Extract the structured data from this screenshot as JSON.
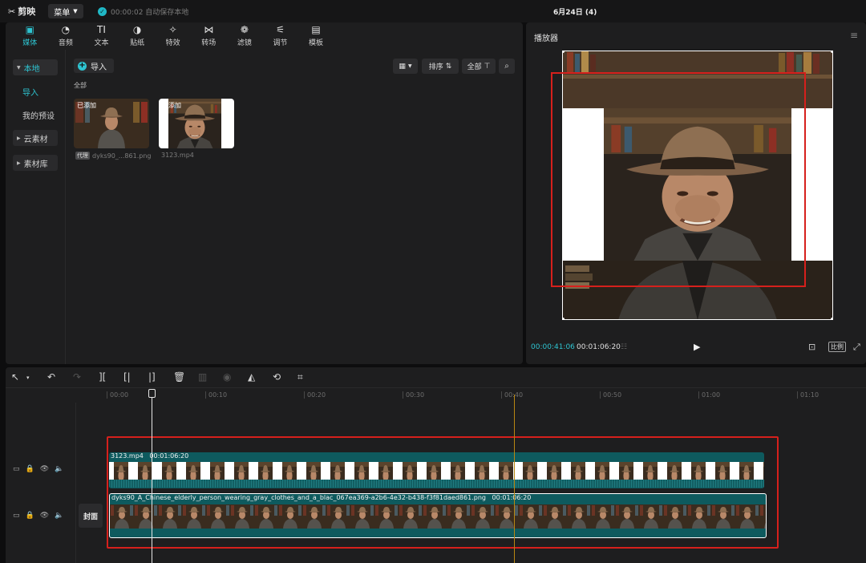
{
  "app": {
    "name": "剪映",
    "menu_label": "菜单",
    "autosave": "00:00:02 自动保存本地",
    "project_title": "6月24日 (4)"
  },
  "toolbar": {
    "tabs": [
      {
        "label": "媒体",
        "icon": "media-icon",
        "glyph": "▣"
      },
      {
        "label": "音频",
        "icon": "audio-icon",
        "glyph": "◔"
      },
      {
        "label": "文本",
        "icon": "text-icon",
        "glyph": "TI"
      },
      {
        "label": "贴纸",
        "icon": "sticker-icon",
        "glyph": "◑"
      },
      {
        "label": "特效",
        "icon": "effects-icon",
        "glyph": "✧"
      },
      {
        "label": "转场",
        "icon": "transition-icon",
        "glyph": "⋈"
      },
      {
        "label": "滤镜",
        "icon": "filter-icon",
        "glyph": "❁"
      },
      {
        "label": "调节",
        "icon": "adjust-icon",
        "glyph": "⚟"
      },
      {
        "label": "模板",
        "icon": "template-icon",
        "glyph": "▤"
      }
    ]
  },
  "sidebar": {
    "local": "本地",
    "import": "导入",
    "my_presets": "我的预设",
    "cloud": "云素材",
    "library": "素材库"
  },
  "media": {
    "import_label": "导入",
    "all_label": "全部",
    "sort_label": "排序",
    "filter_label": "全部",
    "items": [
      {
        "badge": "已添加",
        "filename": "dyks90_...861.png",
        "tag": "代理"
      },
      {
        "badge": "已添加",
        "duration": "01",
        "filename": "3123.mp4"
      }
    ]
  },
  "player": {
    "title": "播放器",
    "current_time": "00:00:41:06",
    "total_time": "00:01:06:20",
    "ratio_label": "比例"
  },
  "timeline": {
    "ruler": [
      "00:00",
      "00:10",
      "00:20",
      "00:30",
      "00:40",
      "00:50",
      "01:00",
      "01:10"
    ],
    "cover_label": "封面",
    "clips": [
      {
        "name": "3123.mp4",
        "duration": "00:01:06:20"
      },
      {
        "name": "dyks90_A_Chinese_elderly_person_wearing_gray_clothes_and_a_blac_067ea369-a2b6-4e32-b438-f3f81daed861.png",
        "duration": "00:01:06:20"
      }
    ]
  },
  "colors": {
    "accent": "#2ec4d1",
    "highlight": "#d6201c",
    "clip_teal": "#0e5a5e",
    "marker": "#b88712"
  }
}
